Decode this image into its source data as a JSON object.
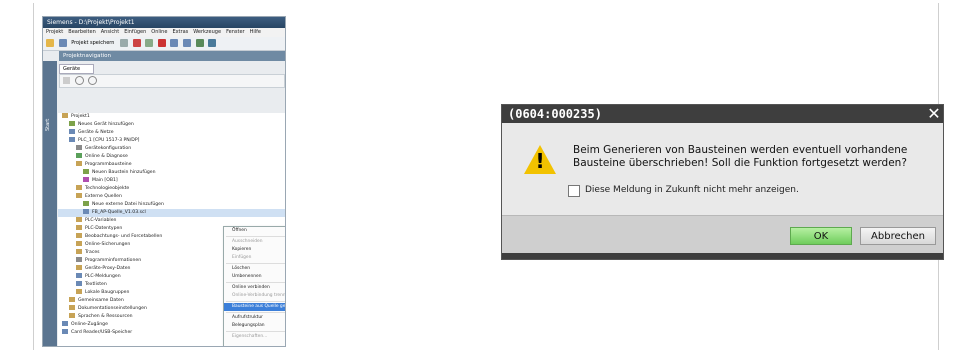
{
  "tia": {
    "title": "Siemens - D:\\Projekt\\Projekt1",
    "menu": [
      "Projekt",
      "Bearbeiten",
      "Ansicht",
      "Einfügen",
      "Online",
      "Extras",
      "Werkzeuge",
      "Fenster",
      "Hilfe"
    ],
    "toolbar_save": "Projekt speichern",
    "nav_header": "Projektnavigation",
    "side_tab": "Start",
    "tab_label": "Geräte",
    "tree": [
      {
        "label": "Projekt1",
        "indent": 0,
        "color": "#c7a356"
      },
      {
        "label": "Neues Gerät hinzufügen",
        "indent": 1,
        "color": "#7da24a"
      },
      {
        "label": "Geräte & Netze",
        "indent": 1,
        "color": "#6a89b5"
      },
      {
        "label": "PLC_1 [CPU 1517-3 PN/DP]",
        "indent": 1,
        "color": "#6a89b5"
      },
      {
        "label": "Gerätekonfiguration",
        "indent": 2,
        "color": "#8a8a8a"
      },
      {
        "label": "Online & Diagnose",
        "indent": 2,
        "color": "#5aa05a"
      },
      {
        "label": "Programmbausteine",
        "indent": 2,
        "color": "#c7a356"
      },
      {
        "label": "Neuen Baustein hinzufügen",
        "indent": 3,
        "color": "#7da24a"
      },
      {
        "label": "Main [OB1]",
        "indent": 3,
        "color": "#b04fb0"
      },
      {
        "label": "Technologieobjekte",
        "indent": 2,
        "color": "#c7a356"
      },
      {
        "label": "Externe Quellen",
        "indent": 2,
        "color": "#c7a356"
      },
      {
        "label": "Neue externe Datei hinzufügen",
        "indent": 3,
        "color": "#7da24a"
      },
      {
        "label": "FB_AP-Quelle_V1.03.scl",
        "indent": 3,
        "color": "#6a89b5",
        "selected": true
      },
      {
        "label": "PLC-Variablen",
        "indent": 2,
        "color": "#c7a356"
      },
      {
        "label": "PLC-Datentypen",
        "indent": 2,
        "color": "#c7a356"
      },
      {
        "label": "Beobachtungs- und Forcetabellen",
        "indent": 2,
        "color": "#c7a356"
      },
      {
        "label": "Online-Sicherungen",
        "indent": 2,
        "color": "#c7a356"
      },
      {
        "label": "Traces",
        "indent": 2,
        "color": "#c7a356"
      },
      {
        "label": "Programminformationen",
        "indent": 2,
        "color": "#8a8a8a"
      },
      {
        "label": "Geräte-Proxy-Daten",
        "indent": 2,
        "color": "#c7a356"
      },
      {
        "label": "PLC-Meldungen",
        "indent": 2,
        "color": "#6a89b5"
      },
      {
        "label": "Textlisten",
        "indent": 2,
        "color": "#6a89b5"
      },
      {
        "label": "Lokale Baugruppen",
        "indent": 2,
        "color": "#c7a356"
      },
      {
        "label": "Gemeinsame Daten",
        "indent": 1,
        "color": "#c7a356"
      },
      {
        "label": "Dokumentationseinstellungen",
        "indent": 1,
        "color": "#c7a356"
      },
      {
        "label": "Sprachen & Ressourcen",
        "indent": 1,
        "color": "#c7a356"
      },
      {
        "label": "Online-Zugänge",
        "indent": 0,
        "color": "#6a89b5"
      },
      {
        "label": "Card Reader/USB-Speicher",
        "indent": 0,
        "color": "#6a89b5"
      }
    ],
    "context_menu": [
      {
        "label": "Öffnen",
        "sc": ""
      },
      {
        "sep": true
      },
      {
        "label": "Ausschneiden",
        "sc": "Strg+X",
        "dis": true
      },
      {
        "label": "Kopieren",
        "sc": "Strg+C"
      },
      {
        "label": "Einfügen",
        "sc": "Strg+V",
        "dis": true
      },
      {
        "sep": true
      },
      {
        "label": "Löschen",
        "sc": "Entf"
      },
      {
        "label": "Umbenennen",
        "sc": "F2"
      },
      {
        "sep": true
      },
      {
        "label": "Online verbinden",
        "sc": "Strg+K"
      },
      {
        "label": "Online-Verbindung trennen",
        "sc": "Strg+M",
        "dis": true
      },
      {
        "sep": true
      },
      {
        "label": "Bausteine aus Quelle generieren",
        "sc": "",
        "hl": true
      },
      {
        "sep": true
      },
      {
        "label": "Aufrufstruktur",
        "sc": ""
      },
      {
        "label": "Belegungsplan",
        "sc": ""
      },
      {
        "sep": true
      },
      {
        "label": "Eigenschaften...",
        "sc": "Alt+Eingabe",
        "dis": true
      }
    ]
  },
  "dialog": {
    "title": "(0604:000235)",
    "close": "✕",
    "message_line1": "Beim Generieren von Bausteinen werden eventuell vorhandene",
    "message_line2": "Bausteine überschrieben! Soll die Funktion fortgesetzt werden?",
    "checkbox_label": "Diese Meldung in Zukunft nicht mehr anzeigen.",
    "checkbox_checked": false,
    "ok_label": "OK",
    "cancel_label": "Abbrechen",
    "warning_mark": "!"
  }
}
